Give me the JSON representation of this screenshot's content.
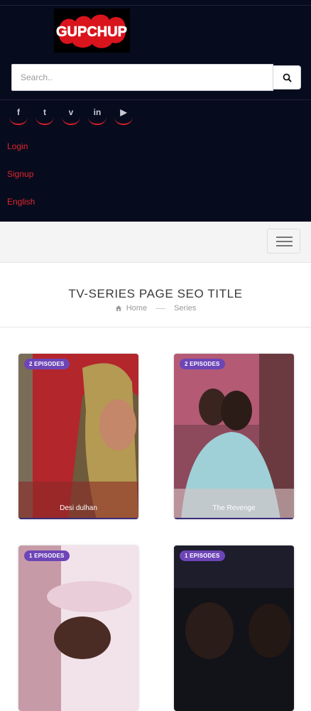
{
  "header": {
    "logo_text": "GUPCHUP",
    "search_placeholder": "Search.."
  },
  "social": {
    "icons": [
      "facebook-icon",
      "twitter-icon",
      "vimeo-icon",
      "linkedin-icon",
      "youtube-icon"
    ],
    "glyphs": [
      "f",
      "t",
      "v",
      "in",
      "▶"
    ]
  },
  "menu": {
    "login": "Login",
    "signup": "Signup",
    "language": "English"
  },
  "page": {
    "title": "TV-SERIES PAGE SEO TITLE",
    "breadcrumb_home": "Home",
    "breadcrumb_current": "Series"
  },
  "series": [
    {
      "badge": "2 EPISODES",
      "title": "Desi dulhan"
    },
    {
      "badge": "2 EPISODES",
      "title": "The Revenge"
    },
    {
      "badge": "1 EPISODES",
      "title": ""
    },
    {
      "badge": "1 EPISODES",
      "title": ""
    }
  ],
  "colors": {
    "header_bg": "#060b1d",
    "accent_red": "#e0262f",
    "badge_purple": "#6d45b7"
  }
}
